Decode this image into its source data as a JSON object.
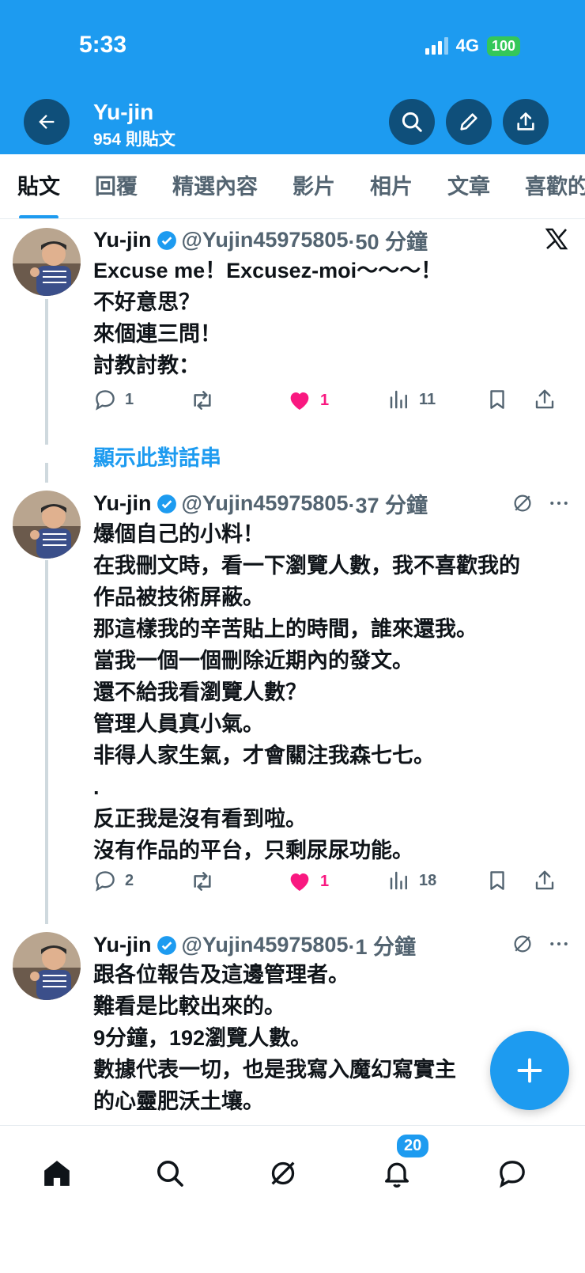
{
  "status_bar": {
    "time": "5:33",
    "network": "4G",
    "battery": "100"
  },
  "header": {
    "title": "Yu-jin",
    "subtitle": "954 則貼文"
  },
  "tabs": [
    {
      "label": "貼文",
      "active": true
    },
    {
      "label": "回覆"
    },
    {
      "label": "精選內容"
    },
    {
      "label": "影片"
    },
    {
      "label": "相片"
    },
    {
      "label": "文章"
    },
    {
      "label": "喜歡的內容"
    }
  ],
  "posts": [
    {
      "name": "Yu-jin",
      "handle": "@Yujin45975805",
      "time": "·50 分鐘",
      "text": "Excuse me！Excusez-moi～～～！\n不好意思？\n來個連三問！\n討教討教：",
      "replies": "1",
      "reposts": "",
      "likes": "1",
      "views": "11"
    },
    {
      "name": "Yu-jin",
      "handle": "@Yujin45975805",
      "time": "·37 分鐘",
      "text": "爆個自己的小料！\n在我刪文時，看一下瀏覽人數，我不喜歡我的\n作品被技術屏蔽。\n那這樣我的辛苦貼上的時間，誰來還我。\n當我一個一個刪除近期內的發文。\n還不給我看瀏覽人數？\n管理人員真小氣。\n非得人家生氣，才會關注我森七七。\n.\n反正我是沒有看到啦。\n沒有作品的平台，只剩尿尿功能。",
      "replies": "2",
      "reposts": "",
      "likes": "1",
      "views": "18"
    },
    {
      "name": "Yu-jin",
      "handle": "@Yujin45975805",
      "time": "·1 分鐘",
      "text": "跟各位報告及這邊管理者。\n難看是比較出來的。\n9分鐘，192瀏覽人數。\n數據代表一切，也是我寫入魔幻寫實主\n的心靈肥沃土壤。"
    }
  ],
  "show_thread": "顯示此對話串",
  "notifications_badge": "20",
  "colors": {
    "brand": "#1d9bf0",
    "like": "#f91880",
    "muted": "#536471"
  }
}
